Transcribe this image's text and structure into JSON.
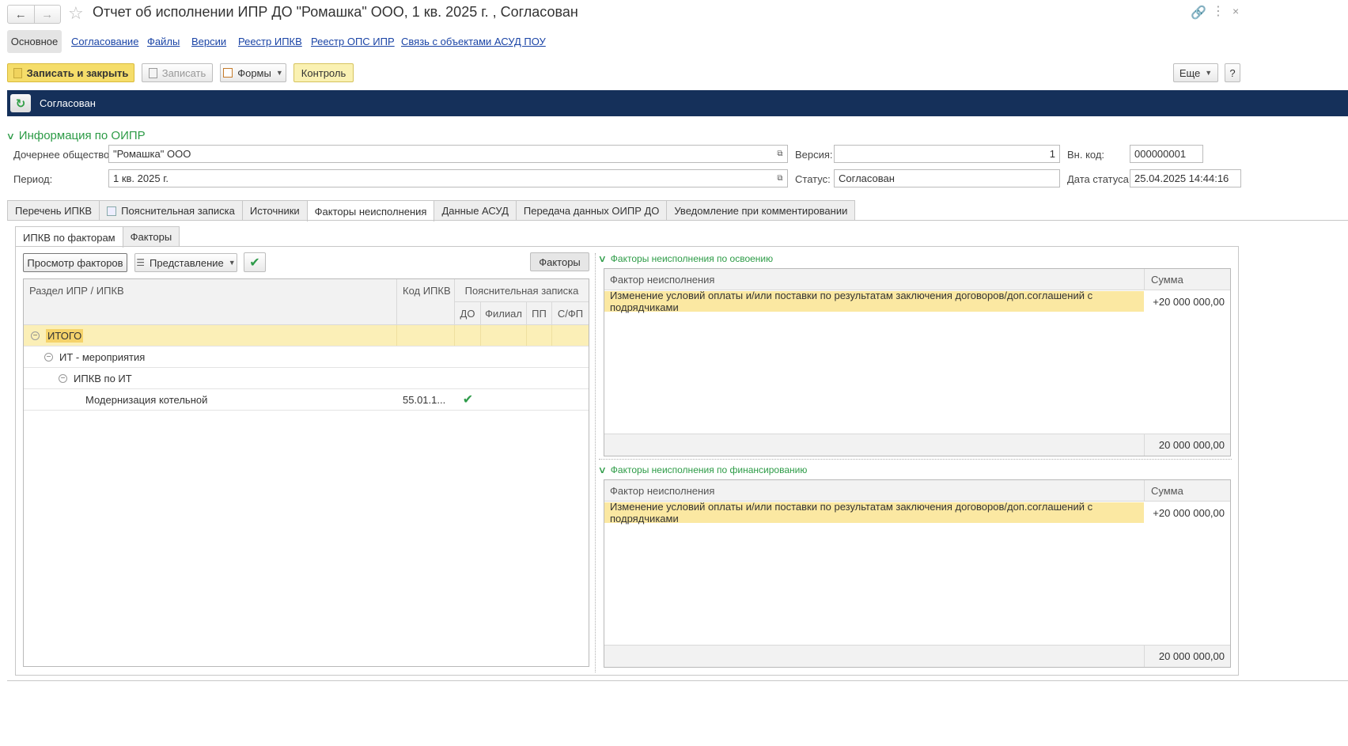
{
  "window": {
    "title": "Отчет об исполнении ИПР ДО \"Ромашка\" ООО, 1 кв. 2025 г. , Согласован",
    "back_icon": "←",
    "forward_icon": "→",
    "star_icon": "☆",
    "link_icon": "🔗",
    "more_icon": "⋮",
    "close_icon": "×"
  },
  "sections": {
    "active": "Основное",
    "links": [
      "Согласование",
      "Файлы",
      "Версии",
      "Реестр ИПКВ",
      "Реестр ОПС ИПР",
      "Связь с объектами АСУД ПОУ"
    ]
  },
  "toolbar": {
    "save_close": "Записать и закрыть",
    "save": "Записать",
    "forms": "Формы",
    "control": "Контроль",
    "more": "Еще",
    "help": "?"
  },
  "status_band": {
    "text": "Согласован",
    "refresh_icon": "↻"
  },
  "info": {
    "title": "Информация по ОИПР",
    "subsidiary_label": "Дочернее общество:",
    "subsidiary_value": "\"Ромашка\" ООО",
    "period_label": "Период:",
    "period_value": "1 кв. 2025 г.",
    "version_label": "Версия:",
    "version_value": "1",
    "status_label": "Статус:",
    "status_value": "Согласован",
    "internal_code_label": "Вн. код:",
    "internal_code_value": "000000001",
    "status_date_label": "Дата статуса:",
    "status_date_value": "25.04.2025 14:44:16"
  },
  "tabs": [
    "Перечень ИПКВ",
    "Пояснительная записка",
    "Источники",
    "Факторы неисполнения",
    "Данные АСУД",
    "Передача данных ОИПР ДО",
    "Уведомление при комментировании"
  ],
  "active_tab": "Факторы неисполнения",
  "subtabs": [
    "ИПКВ по факторам",
    "Факторы"
  ],
  "left_panel": {
    "view_factors": "Просмотр факторов",
    "presentation": "Представление",
    "factors_button": "Факторы",
    "columns": {
      "section": "Раздел ИПР / ИПКВ",
      "code": "Код ИПКВ",
      "note_group": "Пояснительная записка",
      "do": "ДО",
      "branch": "Филиал",
      "pp": "ПП",
      "sfp": "С/ФП"
    },
    "rows": [
      {
        "name": "ИТОГО",
        "code": "",
        "do": ""
      },
      {
        "name": "ИТ - мероприятия",
        "code": "",
        "do": ""
      },
      {
        "name": "ИПКВ по ИТ",
        "code": "",
        "do": ""
      },
      {
        "name": "Модернизация котельной",
        "code": "55.01.1...",
        "do": "✔"
      }
    ]
  },
  "development_factors": {
    "title": "Факторы неисполнения по освоению",
    "col_factor": "Фактор неисполнения",
    "col_sum": "Сумма",
    "row_factor": "Изменение условий оплаты и/или поставки по результатам заключения договоров/доп.соглашений с подрядчиками",
    "row_sum": "+20 000 000,00",
    "total": "20 000 000,00"
  },
  "financing_factors": {
    "title": "Факторы неисполнения по финансированию",
    "col_factor": "Фактор неисполнения",
    "col_sum": "Сумма",
    "row_factor": "Изменение условий оплаты и/или поставки по результатам заключения договоров/доп.соглашений с подрядчиками",
    "row_sum": "+20 000 000,00",
    "total": "20 000 000,00"
  }
}
